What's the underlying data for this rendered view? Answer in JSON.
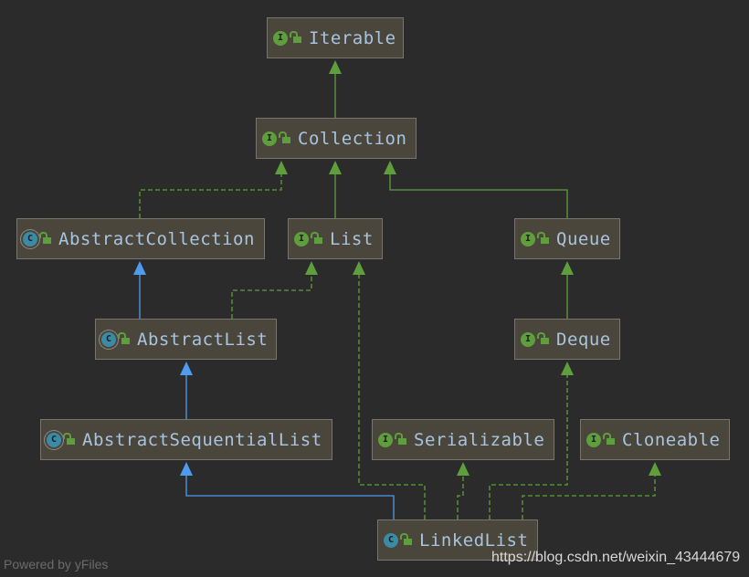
{
  "nodes": [
    {
      "id": "Iterable",
      "label": "Iterable",
      "kind": "interface"
    },
    {
      "id": "Collection",
      "label": "Collection",
      "kind": "interface"
    },
    {
      "id": "AbstractCollection",
      "label": "AbstractCollection",
      "kind": "abstract-class"
    },
    {
      "id": "List",
      "label": "List",
      "kind": "interface"
    },
    {
      "id": "Queue",
      "label": "Queue",
      "kind": "interface"
    },
    {
      "id": "AbstractList",
      "label": "AbstractList",
      "kind": "abstract-class"
    },
    {
      "id": "Deque",
      "label": "Deque",
      "kind": "interface"
    },
    {
      "id": "AbstractSequentialList",
      "label": "AbstractSequentialList",
      "kind": "abstract-class"
    },
    {
      "id": "Serializable",
      "label": "Serializable",
      "kind": "interface"
    },
    {
      "id": "Cloneable",
      "label": "Cloneable",
      "kind": "interface"
    },
    {
      "id": "LinkedList",
      "label": "LinkedList",
      "kind": "class"
    }
  ],
  "badge_letters": {
    "interface": "I",
    "class": "C",
    "abstract-class": "C"
  },
  "edges": [
    {
      "from": "Collection",
      "to": "Iterable",
      "type": "extends-interface"
    },
    {
      "from": "List",
      "to": "Collection",
      "type": "extends-interface"
    },
    {
      "from": "Queue",
      "to": "Collection",
      "type": "extends-interface"
    },
    {
      "from": "AbstractCollection",
      "to": "Collection",
      "type": "implements"
    },
    {
      "from": "AbstractList",
      "to": "List",
      "type": "implements"
    },
    {
      "from": "AbstractList",
      "to": "AbstractCollection",
      "type": "extends-class"
    },
    {
      "from": "Deque",
      "to": "Queue",
      "type": "extends-interface"
    },
    {
      "from": "AbstractSequentialList",
      "to": "AbstractList",
      "type": "extends-class"
    },
    {
      "from": "LinkedList",
      "to": "AbstractSequentialList",
      "type": "extends-class"
    },
    {
      "from": "LinkedList",
      "to": "List",
      "type": "implements"
    },
    {
      "from": "LinkedList",
      "to": "Serializable",
      "type": "implements"
    },
    {
      "from": "LinkedList",
      "to": "Deque",
      "type": "implements"
    },
    {
      "from": "LinkedList",
      "to": "Cloneable",
      "type": "implements"
    }
  ],
  "colors": {
    "interface_edge": "#5f9e3d",
    "class_edge": "#4e9bf0",
    "background": "#2b2b2b",
    "node_fill": "#4b463b",
    "label": "#a8c4e0"
  },
  "footer": "Powered by yFiles",
  "watermark": "https://blog.csdn.net/weixin_43444679"
}
